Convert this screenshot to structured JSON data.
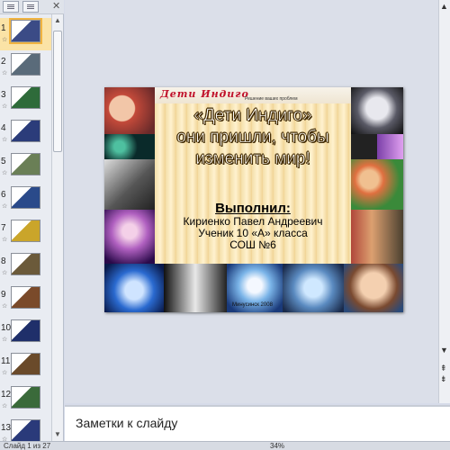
{
  "thumbnails": [
    {
      "num": "1",
      "selected": true,
      "color": "#3b4b86"
    },
    {
      "num": "2",
      "selected": false,
      "color": "#5a6b7a"
    },
    {
      "num": "3",
      "selected": false,
      "color": "#2e6b3a"
    },
    {
      "num": "4",
      "selected": false,
      "color": "#2b3c7a"
    },
    {
      "num": "5",
      "selected": false,
      "color": "#6a7f56"
    },
    {
      "num": "6",
      "selected": false,
      "color": "#2a4a8a"
    },
    {
      "num": "7",
      "selected": false,
      "color": "#caa52a"
    },
    {
      "num": "8",
      "selected": false,
      "color": "#6b5a3a"
    },
    {
      "num": "9",
      "selected": false,
      "color": "#7a4a2a"
    },
    {
      "num": "10",
      "selected": false,
      "color": "#1f2f6a"
    },
    {
      "num": "11",
      "selected": false,
      "color": "#6a4a2a"
    },
    {
      "num": "12",
      "selected": false,
      "color": "#3a6a3a"
    },
    {
      "num": "13",
      "selected": false,
      "color": "#2a3a7a"
    }
  ],
  "slide": {
    "banner_title": "Дети Индиго",
    "banner_subtitle": "Решение ваших проблем",
    "title_lines": [
      "«Дети Индиго»",
      "они пришли, чтобы",
      "изменить мир!"
    ],
    "author_label": "Выполнил:",
    "author_lines": [
      "Кириенко Павел Андреевич",
      "Ученик 10 «А» класса",
      "СОШ №6"
    ],
    "footer": "Минусинск  2008"
  },
  "notes": {
    "placeholder": "Заметки к слайду"
  },
  "status": {
    "slide_info": "Слайд 1 из 27",
    "zoom": "34%"
  },
  "colors": {
    "accent_selection": "#f0b340",
    "banner_red": "#c0102a"
  }
}
